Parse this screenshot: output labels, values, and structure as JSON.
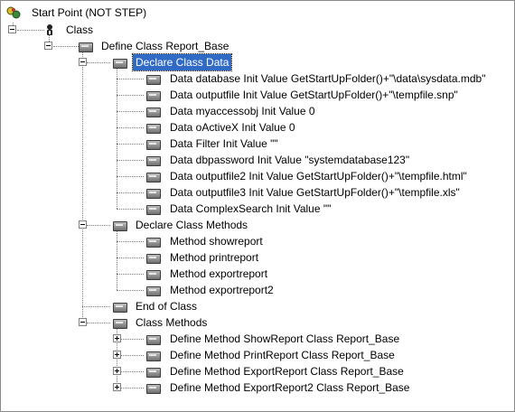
{
  "tree": {
    "root": "Start Point (NOT STEP)",
    "class_node": "Class",
    "define_class": "Define Class Report_Base",
    "declare_data": "Declare Class Data",
    "data_items": [
      "Data database Init Value GetStartUpFolder()+\"\\data\\sysdata.mdb\"",
      "Data outputfile Init Value GetStartUpFolder()+\"\\tempfile.snp\"",
      "Data myaccessobj Init Value 0",
      "Data oActiveX Init Value 0",
      "Data Filter Init Value \"\"",
      "Data dbpassword Init Value \"systemdatabase123\"",
      "Data outputfile2 Init Value GetStartUpFolder()+\"\\tempfile.html\"",
      "Data outputfile3 Init Value GetStartUpFolder()+\"\\tempfile.xls\"",
      "Data ComplexSearch Init Value \"\""
    ],
    "declare_methods": "Declare Class Methods",
    "method_items": [
      "Method showreport",
      "Method printreport",
      "Method exportreport",
      "Method exportreport2"
    ],
    "end_of_class": "End of Class",
    "class_methods": "Class Methods",
    "define_methods": [
      "Define Method ShowReport Class Report_Base",
      "Define Method PrintReport Class Report_Base",
      "Define Method ExportReport Class Report_Base",
      "Define Method ExportReport2 Class Report_Base"
    ]
  }
}
